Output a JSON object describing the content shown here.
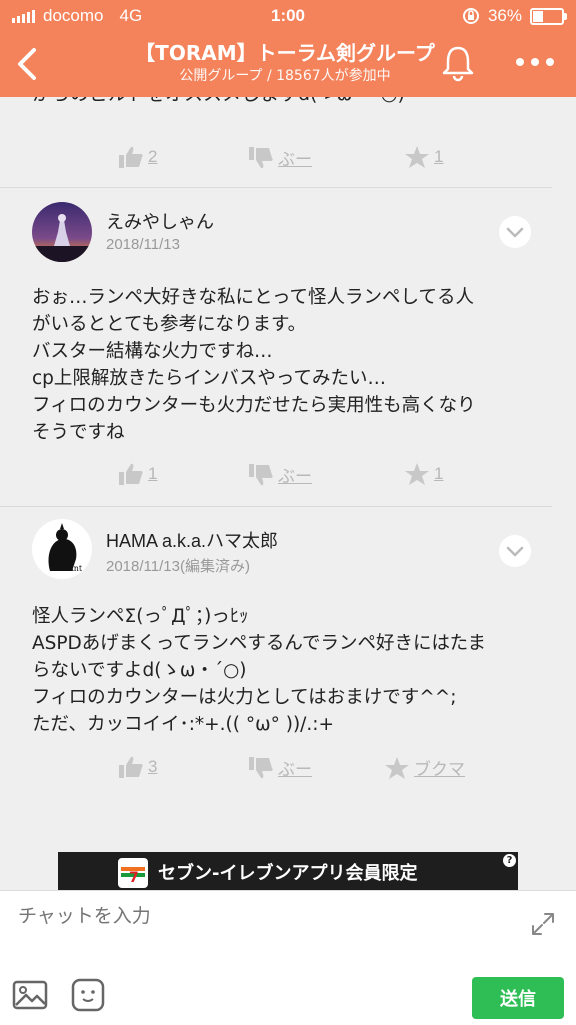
{
  "status_bar": {
    "carrier": "docomo",
    "network": "4G",
    "time": "1:00",
    "battery": "36%"
  },
  "header": {
    "title": "【TORAM】トーラム剣グループ",
    "subtitle": "公開グループ / 18567人が参加中"
  },
  "colors": {
    "header_bg": "#f4825a",
    "send_button": "#2fbe56",
    "action_gray": "#b8b8b8"
  },
  "posts": [
    {
      "snippet": "からのビルドをオススメしますd(ゝω・´○)",
      "actions": {
        "likes": "2",
        "dislike": "ぶー",
        "stars": "1"
      }
    },
    {
      "author": "えみやしゃん",
      "date": "2018/11/13",
      "lines": [
        "おぉ…ランペ大好きな私にとって怪人ランペしてる人",
        "がいるととても参考になります。",
        "バスター結構な火力ですね…",
        "cp上限解放きたらインバスやってみたい…",
        "フィロのカウンターも火力だせたら実用性も高くなり",
        "そうですね"
      ],
      "actions": {
        "likes": "1",
        "dislike": "ぶー",
        "stars": "1"
      }
    },
    {
      "author": "HAMA a.k.a.ハマ太郎",
      "date": "2018/11/13(編集済み)",
      "lines": [
        "怪人ランペΣ(っﾟДﾟ；)っﾋｯ",
        "ASPDあげまくってランペするんでランペ好きにはたま",
        "らないですよd(ゝω・´○)",
        "フィロのカウンターは火力としてはおまけです^^;",
        "ただ、カッコイイ･:*+.(( °ω° ))/.:+"
      ],
      "actions": {
        "likes": "3",
        "dislike": "ぶー",
        "bookmark": "ブクマ"
      }
    }
  ],
  "ad": {
    "text": "セブン-イレブンアプリ会員限定",
    "badge": "?"
  },
  "composer": {
    "placeholder": "チャットを入力",
    "send_label": "送信"
  },
  "icons": [
    "back-chevron-icon",
    "bell-icon",
    "more-dots-icon",
    "thumbs-up-icon",
    "thumbs-down-icon",
    "star-icon",
    "chevron-down-icon",
    "expand-icon",
    "image-icon",
    "stamp-icon"
  ]
}
